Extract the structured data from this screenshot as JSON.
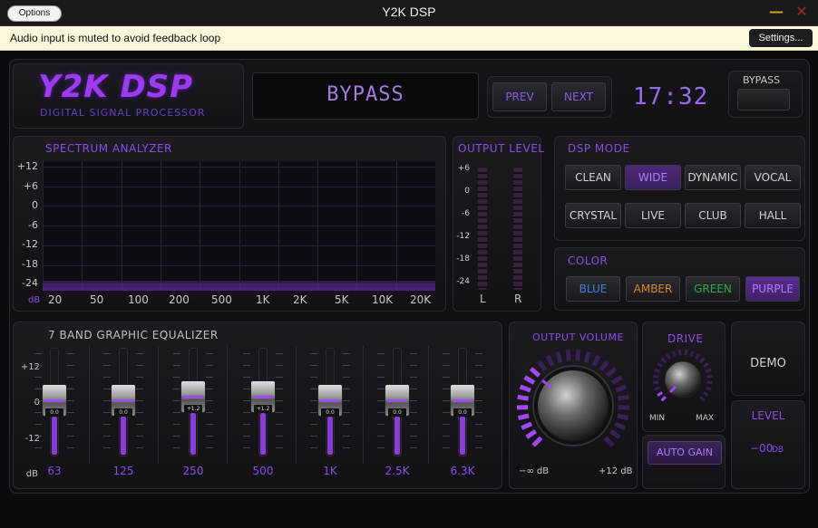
{
  "window": {
    "title": "Y2K DSP",
    "options_label": "Options",
    "minimize_glyph": "—",
    "close_glyph": "✕"
  },
  "notice": {
    "text": "Audio input is muted to avoid feedback loop",
    "settings_label": "Settings..."
  },
  "header": {
    "logo": "Y2K DSP",
    "logo_sub": "DIGITAL SIGNAL PROCESSOR",
    "display": "BYPASS",
    "prev_label": "PREV",
    "next_label": "NEXT",
    "clock": "17:32",
    "bypass_label": "BYPASS"
  },
  "spectrum": {
    "title": "SPECTRUM ANALYZER",
    "y_ticks": [
      "+12",
      "+6",
      "0",
      "-6",
      "-12",
      "-18",
      "-24"
    ],
    "unit": "dB",
    "x_ticks": [
      "20",
      "50",
      "100",
      "200",
      "500",
      "1K",
      "2K",
      "5K",
      "10K",
      "20K"
    ]
  },
  "output_level": {
    "title": "OUTPUT LEVEL",
    "ticks": [
      "+6",
      "0",
      "-6",
      "-12",
      "-18",
      "-24"
    ],
    "left": "L",
    "right": "R"
  },
  "dsp_mode": {
    "title": "DSP MODE",
    "modes": [
      "CLEAN",
      "WIDE",
      "DYNAMIC",
      "VOCAL",
      "CRYSTAL",
      "LIVE",
      "CLUB",
      "HALL"
    ],
    "active": "WIDE"
  },
  "color": {
    "title": "COLOR",
    "options": [
      {
        "label": "BLUE",
        "color": "#3f7fe0"
      },
      {
        "label": "AMBER",
        "color": "#d88a1c"
      },
      {
        "label": "GREEN",
        "color": "#2ea84a"
      },
      {
        "label": "PURPLE",
        "color": "#b07aff"
      }
    ],
    "active": "PURPLE"
  },
  "equalizer": {
    "title": "7 BAND GRAPHIC EQUALIZER",
    "ticks": [
      "+12",
      "0",
      "-12"
    ],
    "unit": "dB",
    "bands": [
      {
        "freq": "63",
        "value": "0.0",
        "gain": 0
      },
      {
        "freq": "125",
        "value": "0.0",
        "gain": 0
      },
      {
        "freq": "250",
        "value": "+1.2",
        "gain": 1.2
      },
      {
        "freq": "500",
        "value": "+1.2",
        "gain": 1.2
      },
      {
        "freq": "1K",
        "value": "0.0",
        "gain": 0
      },
      {
        "freq": "2.5K",
        "value": "0.0",
        "gain": 0
      },
      {
        "freq": "6.3K",
        "value": "0.0",
        "gain": 0
      }
    ]
  },
  "volume": {
    "title": "OUTPUT VOLUME",
    "min_label": "−∞ dB",
    "max_label": "+12 dB"
  },
  "drive": {
    "title": "DRIVE",
    "min_label": "MIN",
    "max_label": "MAX",
    "auto_gain_label": "AUTO GAIN"
  },
  "demo": {
    "label": "DEMO"
  },
  "level": {
    "title": "LEVEL",
    "value": "−00",
    "unit": "DB"
  }
}
